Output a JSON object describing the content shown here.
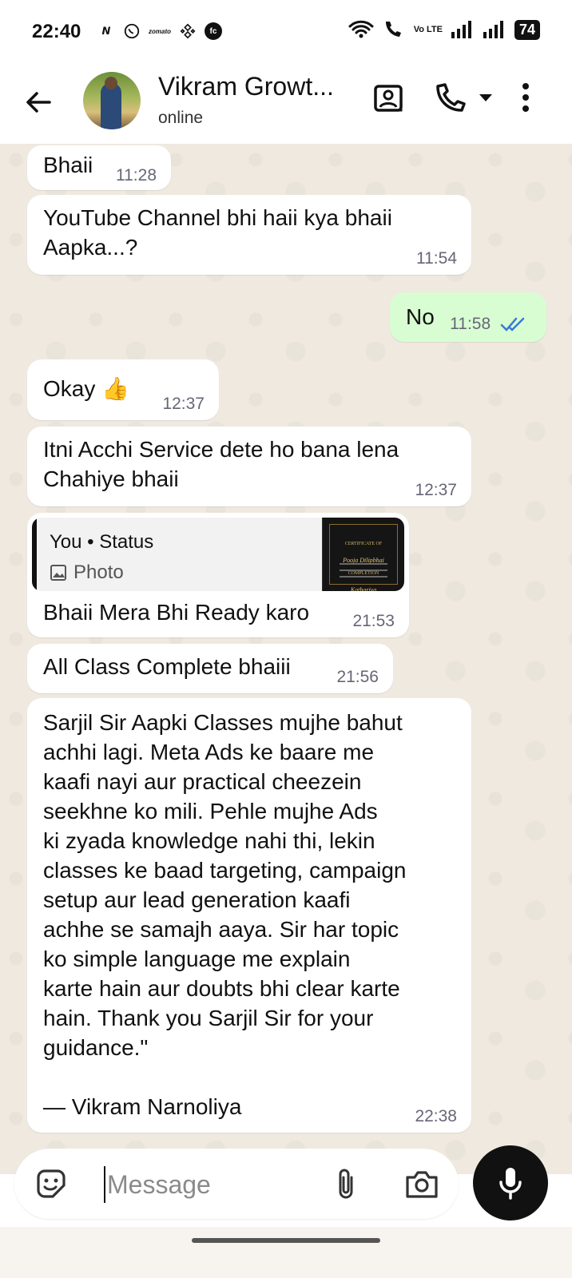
{
  "status_bar": {
    "time": "22:40",
    "app_icons": [
      "N",
      "whatsapp-business",
      "zomato",
      "binance",
      "fc"
    ],
    "volte": "Vo LTE",
    "battery": "74"
  },
  "header": {
    "contact_name": "Vikram Growt...",
    "contact_status": "online"
  },
  "messages": [
    {
      "dir": "in",
      "text": "Bhaii",
      "time": "11:28"
    },
    {
      "dir": "in",
      "text": "YouTube Channel bhi haii kya bhaii\nAapka...?",
      "time": "11:54"
    },
    {
      "dir": "out",
      "text": "No",
      "time": "11:58",
      "read": true
    },
    {
      "dir": "in",
      "text": "Okay 👍",
      "time": "12:37"
    },
    {
      "dir": "in",
      "text": "Itni Acchi Service dete ho bana lena\nChahiye bhaii",
      "time": "12:37"
    },
    {
      "dir": "in",
      "reply": {
        "who": "You • Status",
        "type": "Photo",
        "thumb_title": "CERTIFICATE OF COMPLETION",
        "thumb_name": "Pooja Dilipbhai Kathariya"
      },
      "text": "Bhaii Mera Bhi Ready karo",
      "time": "21:53"
    },
    {
      "dir": "in",
      "text": "All Class Complete bhaiii",
      "time": "21:56"
    },
    {
      "dir": "in",
      "text": "Sarjil Sir Aapki Classes mujhe bahut\nachhi lagi. Meta Ads ke baare me\nkaafi nayi aur practical cheezein\nseekhne ko mili. Pehle mujhe Ads\nki zyada knowledge nahi thi, lekin\nclasses ke baad targeting, campaign\nsetup aur lead generation kaafi\nachhe se samajh aaya. Sir har topic\nko simple language me explain\nkarte hain aur doubts bhi clear karte\nhain. Thank you Sarjil Sir for your\nguidance.\"\n\n— Vikram Narnoliya",
      "time": "22:38"
    }
  ],
  "composer": {
    "placeholder": "Message"
  },
  "colors": {
    "chat_bg": "#efe9df",
    "incoming": "#ffffff",
    "outgoing": "#d9fdd3",
    "read_ticks": "#3a7bd5"
  }
}
